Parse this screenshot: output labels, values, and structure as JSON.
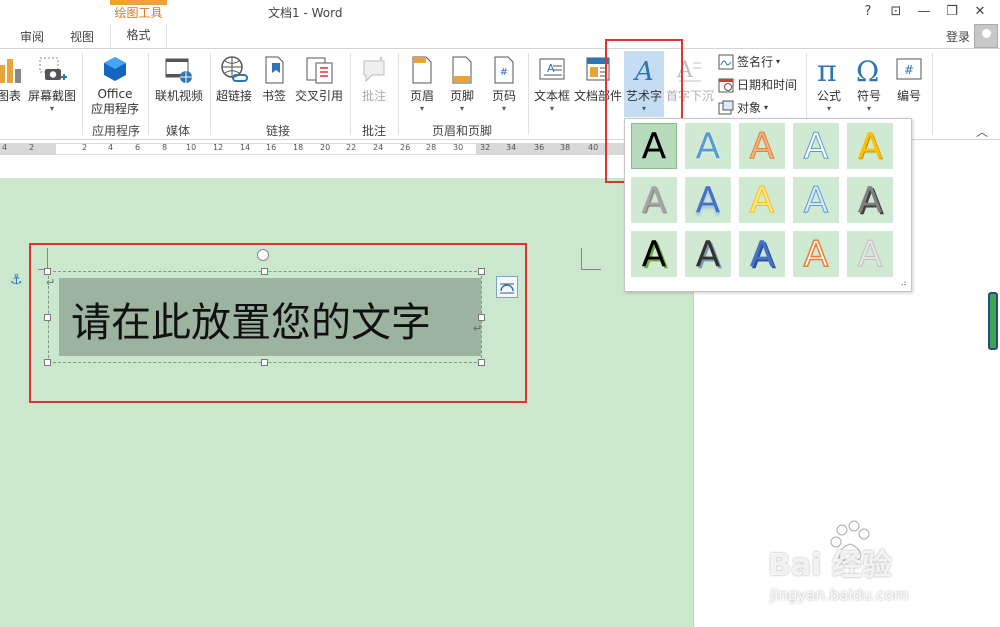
{
  "titlebar": {
    "context_group": "绘图工具",
    "doc_title": "文档1 - Word",
    "help": "?",
    "ribbon_display": "⊡",
    "minimize": "—",
    "restore": "❐",
    "close": "✕"
  },
  "tabs": {
    "review": "审阅",
    "view": "视图",
    "format": "格式",
    "login": "登录"
  },
  "ribbon": {
    "chart": "图表",
    "screenshot": "屏幕截图",
    "office_apps_line1": "Office",
    "office_apps_line2": "应用程序",
    "online_video": "联机视频",
    "hyperlink": "超链接",
    "bookmark": "书签",
    "cross_ref": "交叉引用",
    "comment": "批注",
    "header": "页眉",
    "footer": "页脚",
    "page_number": "页码",
    "textbox": "文本框",
    "quick_parts": "文档部件",
    "wordart": "艺术字",
    "dropcap": "首字下沉",
    "signature_line": "签名行",
    "date_time": "日期和时间",
    "object": "对象",
    "equation": "公式",
    "symbol": "符号",
    "number": "编号",
    "groups": {
      "apps": "应用程序",
      "media": "媒体",
      "links": "链接",
      "comments": "批注",
      "header_footer": "页眉和页脚"
    }
  },
  "ruler": {
    "ticks": [
      "4",
      "2",
      "2",
      "4",
      "6",
      "8",
      "10",
      "12",
      "14",
      "16",
      "18",
      "20",
      "22",
      "24",
      "26",
      "28",
      "30",
      "32",
      "34",
      "36",
      "38",
      "40"
    ]
  },
  "document": {
    "textbox_text": "请在此放置您的文字"
  },
  "gallery": {
    "letter": "A"
  },
  "watermark": {
    "brand": "Bai  经验",
    "url": "jingyan.baidu.com"
  },
  "colors": {
    "accent_blue": "#2e75b6",
    "context_orange": "#f2a13a",
    "page_green": "#cbe8cf",
    "highlight_red": "#e03434"
  }
}
